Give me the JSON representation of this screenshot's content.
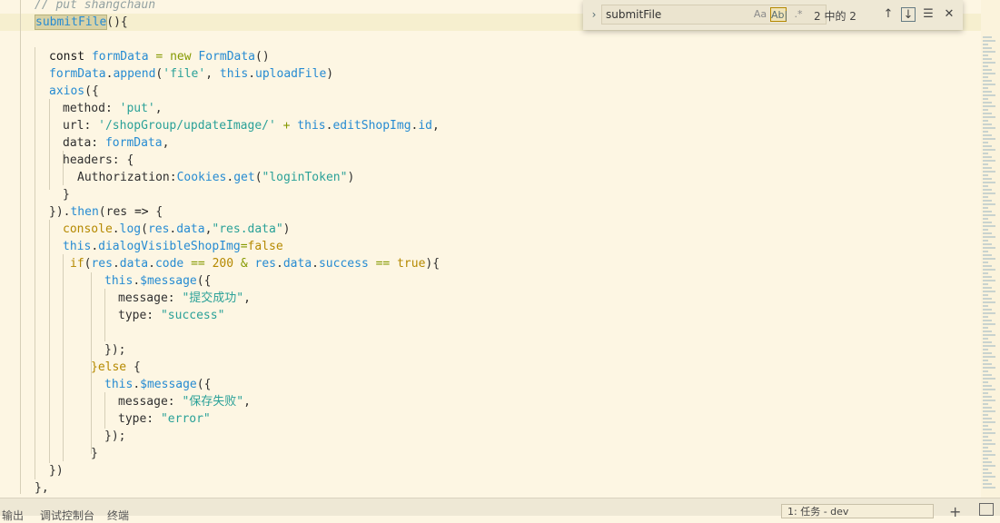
{
  "editor": {
    "lines": [
      {
        "tokens": [
          {
            "t": "// put shangchaun",
            "c": "cm"
          }
        ]
      },
      {
        "tokens": [
          {
            "t": "submitFile",
            "c": "var",
            "m": true
          },
          {
            "t": "(){",
            "c": "prop"
          }
        ],
        "active": true
      },
      {
        "tokens": []
      },
      {
        "tokens": [
          {
            "t": "const ",
            "c": "kw"
          },
          {
            "t": "formData",
            "c": "var"
          },
          {
            "t": " = ",
            "c": "op"
          },
          {
            "t": "new ",
            "c": "op"
          },
          {
            "t": "FormData",
            "c": "fn"
          },
          {
            "t": "()",
            "c": "prop"
          }
        ]
      },
      {
        "tokens": [
          {
            "t": "formData",
            "c": "var"
          },
          {
            "t": ".",
            "c": "prop"
          },
          {
            "t": "append",
            "c": "fn"
          },
          {
            "t": "(",
            "c": "prop"
          },
          {
            "t": "'file'",
            "c": "str"
          },
          {
            "t": ", ",
            "c": "prop"
          },
          {
            "t": "this",
            "c": "this"
          },
          {
            "t": ".",
            "c": "prop"
          },
          {
            "t": "uploadFile",
            "c": "var"
          },
          {
            "t": ")",
            "c": "prop"
          }
        ]
      },
      {
        "tokens": [
          {
            "t": "axios",
            "c": "fn"
          },
          {
            "t": "({",
            "c": "prop"
          }
        ]
      },
      {
        "tokens": [
          {
            "t": "method: ",
            "c": "prop"
          },
          {
            "t": "'put'",
            "c": "str"
          },
          {
            "t": ",",
            "c": "prop"
          }
        ]
      },
      {
        "tokens": [
          {
            "t": "url: ",
            "c": "prop"
          },
          {
            "t": "'/shopGroup/updateImage/'",
            "c": "str"
          },
          {
            "t": " + ",
            "c": "op"
          },
          {
            "t": "this",
            "c": "this"
          },
          {
            "t": ".",
            "c": "prop"
          },
          {
            "t": "editShopImg",
            "c": "var"
          },
          {
            "t": ".",
            "c": "prop"
          },
          {
            "t": "id",
            "c": "var"
          },
          {
            "t": ",",
            "c": "prop"
          }
        ]
      },
      {
        "tokens": [
          {
            "t": "data: ",
            "c": "prop"
          },
          {
            "t": "formData",
            "c": "var"
          },
          {
            "t": ",",
            "c": "prop"
          }
        ]
      },
      {
        "tokens": [
          {
            "t": "headers: {",
            "c": "prop"
          }
        ]
      },
      {
        "tokens": [
          {
            "t": "Authorization:",
            "c": "prop"
          },
          {
            "t": "Cookies",
            "c": "fn"
          },
          {
            "t": ".",
            "c": "prop"
          },
          {
            "t": "get",
            "c": "fn"
          },
          {
            "t": "(",
            "c": "prop"
          },
          {
            "t": "\"loginToken\"",
            "c": "str"
          },
          {
            "t": ")",
            "c": "prop"
          }
        ]
      },
      {
        "tokens": [
          {
            "t": "}",
            "c": "prop"
          }
        ]
      },
      {
        "tokens": [
          {
            "t": "}).",
            "c": "prop"
          },
          {
            "t": "then",
            "c": "fn"
          },
          {
            "t": "(res ",
            "c": "prop"
          },
          {
            "t": "=>",
            "c": "kw"
          },
          {
            "t": " {",
            "c": "prop"
          }
        ]
      },
      {
        "tokens": [
          {
            "t": "console",
            "c": "ident"
          },
          {
            "t": ".",
            "c": "prop"
          },
          {
            "t": "log",
            "c": "fn"
          },
          {
            "t": "(",
            "c": "prop"
          },
          {
            "t": "res",
            "c": "var"
          },
          {
            "t": ".",
            "c": "prop"
          },
          {
            "t": "data",
            "c": "var"
          },
          {
            "t": ",",
            "c": "prop"
          },
          {
            "t": "\"res.data\"",
            "c": "str"
          },
          {
            "t": ")",
            "c": "prop"
          }
        ]
      },
      {
        "tokens": [
          {
            "t": "this",
            "c": "this"
          },
          {
            "t": ".",
            "c": "prop"
          },
          {
            "t": "dialogVisibleShopImg",
            "c": "var"
          },
          {
            "t": "=",
            "c": "op"
          },
          {
            "t": "false",
            "c": "bool"
          }
        ]
      },
      {
        "tokens": [
          {
            "t": "if",
            "c": "ident"
          },
          {
            "t": "(",
            "c": "prop"
          },
          {
            "t": "res",
            "c": "var"
          },
          {
            "t": ".",
            "c": "prop"
          },
          {
            "t": "data",
            "c": "var"
          },
          {
            "t": ".",
            "c": "prop"
          },
          {
            "t": "code",
            "c": "var"
          },
          {
            "t": " == ",
            "c": "op"
          },
          {
            "t": "200",
            "c": "num"
          },
          {
            "t": " & ",
            "c": "op"
          },
          {
            "t": "res",
            "c": "var"
          },
          {
            "t": ".",
            "c": "prop"
          },
          {
            "t": "data",
            "c": "var"
          },
          {
            "t": ".",
            "c": "prop"
          },
          {
            "t": "success",
            "c": "var"
          },
          {
            "t": " == ",
            "c": "op"
          },
          {
            "t": "true",
            "c": "bool"
          },
          {
            "t": "){",
            "c": "prop"
          }
        ]
      },
      {
        "tokens": [
          {
            "t": "this",
            "c": "this"
          },
          {
            "t": ".",
            "c": "prop"
          },
          {
            "t": "$message",
            "c": "var"
          },
          {
            "t": "({",
            "c": "prop"
          }
        ]
      },
      {
        "tokens": [
          {
            "t": "message: ",
            "c": "prop"
          },
          {
            "t": "\"提交成功\"",
            "c": "str"
          },
          {
            "t": ",",
            "c": "prop"
          }
        ]
      },
      {
        "tokens": [
          {
            "t": "type: ",
            "c": "prop"
          },
          {
            "t": "\"success\"",
            "c": "str"
          }
        ]
      },
      {
        "tokens": []
      },
      {
        "tokens": [
          {
            "t": "});",
            "c": "prop"
          }
        ]
      },
      {
        "tokens": [
          {
            "t": "}",
            "c": "ident"
          },
          {
            "t": "else",
            "c": "ident"
          },
          {
            "t": " {",
            "c": "prop"
          }
        ]
      },
      {
        "tokens": [
          {
            "t": "this",
            "c": "this"
          },
          {
            "t": ".",
            "c": "prop"
          },
          {
            "t": "$message",
            "c": "var"
          },
          {
            "t": "({",
            "c": "prop"
          }
        ]
      },
      {
        "tokens": [
          {
            "t": "message: ",
            "c": "prop"
          },
          {
            "t": "\"保存失败\"",
            "c": "str"
          },
          {
            "t": ",",
            "c": "prop"
          }
        ]
      },
      {
        "tokens": [
          {
            "t": "type: ",
            "c": "prop"
          },
          {
            "t": "\"error\"",
            "c": "str"
          }
        ]
      },
      {
        "tokens": [
          {
            "t": "});",
            "c": "prop"
          }
        ]
      },
      {
        "tokens": [
          {
            "t": "}",
            "c": "prop"
          }
        ]
      },
      {
        "tokens": [
          {
            "t": "})",
            "c": "prop"
          }
        ]
      },
      {
        "tokens": [
          {
            "t": "},",
            "c": "prop"
          }
        ]
      }
    ]
  },
  "find": {
    "query": "submitFile",
    "toggle_icon": "chevron-right-icon",
    "match_case_label": "Aa",
    "whole_word_label": "Ab|",
    "regex_label": ".*",
    "match_count": "2 中的 2"
  },
  "panel": {
    "tabs": [
      "输出",
      "调试控制台",
      "终端"
    ],
    "task_selector": "1: 任务 - dev"
  },
  "colors": {
    "background": "#fdf6e3",
    "keyword_blue": "#268bd2",
    "string_teal": "#2aa198",
    "accent_yellow": "#b58900",
    "operator_green": "#859900"
  }
}
